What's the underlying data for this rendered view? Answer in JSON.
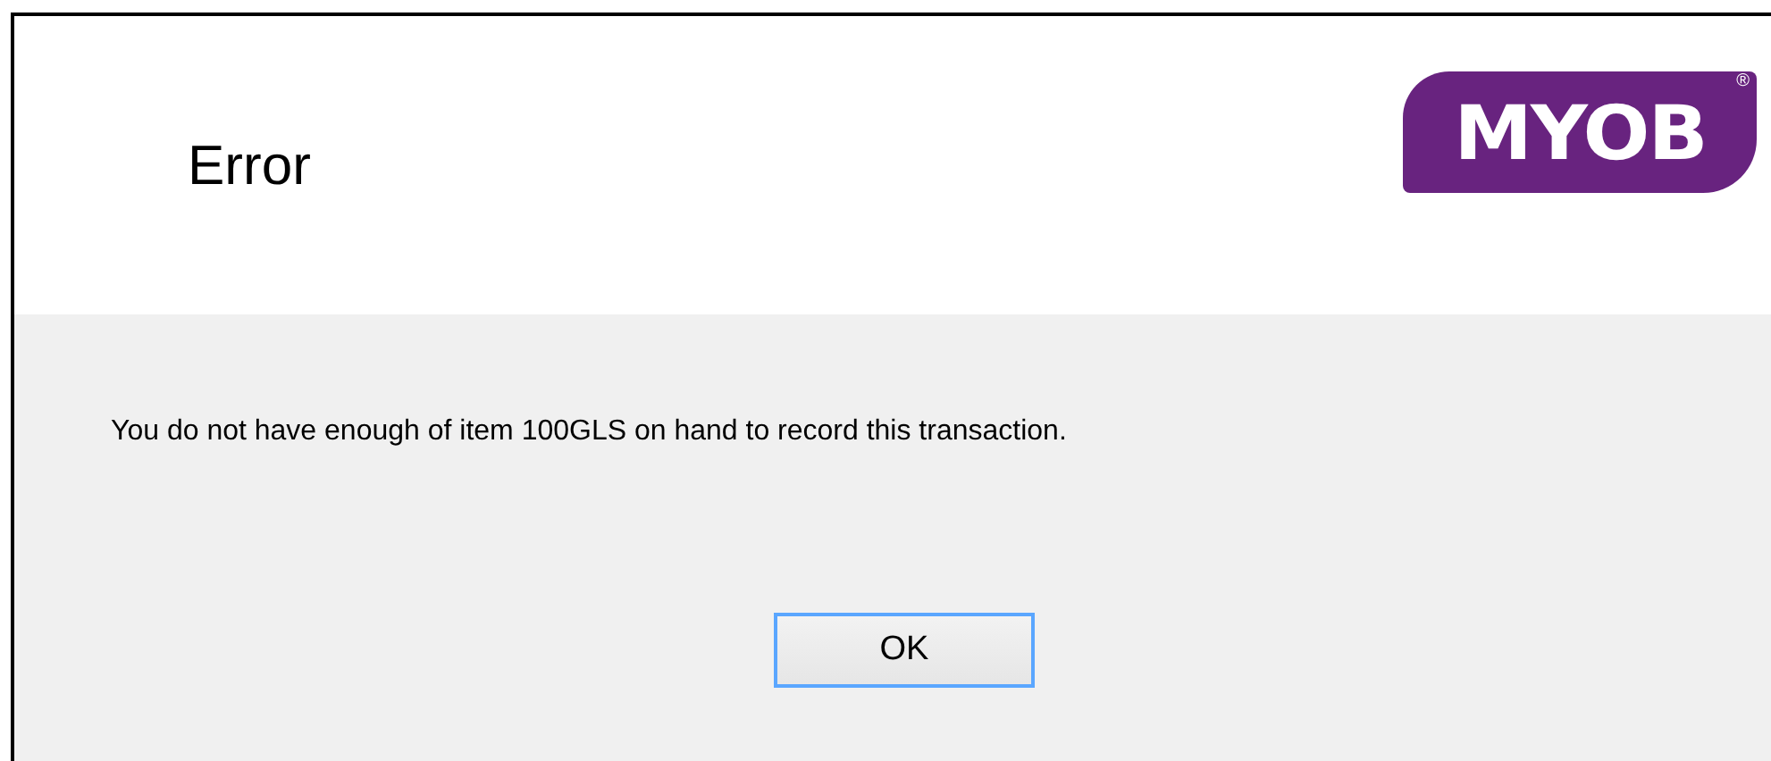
{
  "window": {
    "title": "Error"
  },
  "logo": {
    "text": "MYOB",
    "mark": "®"
  },
  "message": "You do not have enough of item 100GLS on hand to record this transaction.",
  "buttons": [
    {
      "label": "OK",
      "focused": true
    }
  ]
}
